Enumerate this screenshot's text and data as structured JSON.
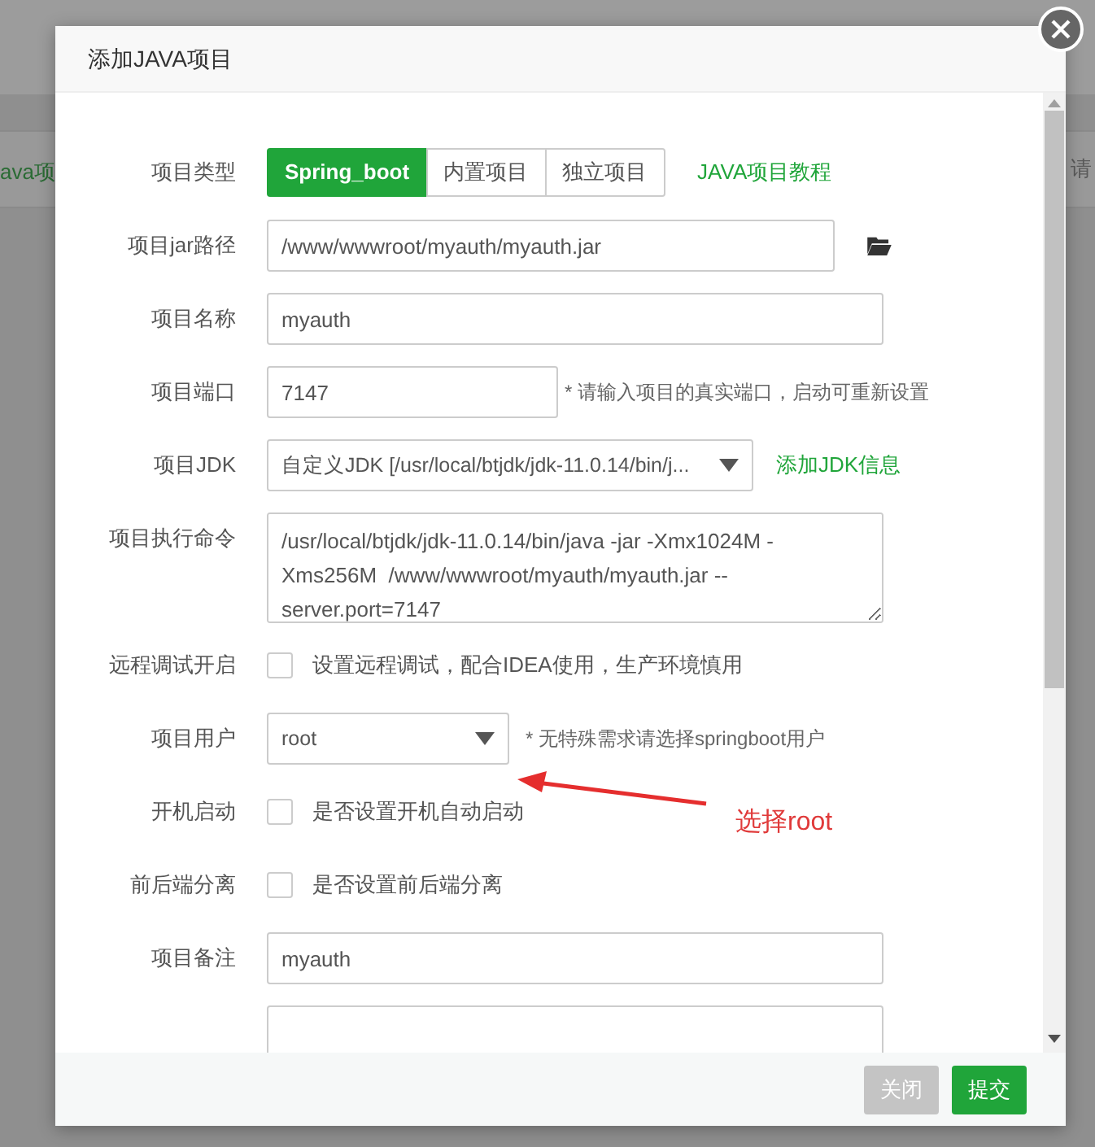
{
  "background": {
    "texts": [
      "ava项",
      "请"
    ]
  },
  "dialog": {
    "title": "添加JAVA项目",
    "fields": [
      {
        "kind": "segmented",
        "label": "项目类型",
        "options": [
          {
            "label": "Spring_boot",
            "selected": true
          },
          {
            "label": "内置项目",
            "selected": false
          },
          {
            "label": "独立项目",
            "selected": false
          }
        ],
        "link": "JAVA项目教程"
      },
      {
        "kind": "path",
        "label": "项目jar路径",
        "value": "/www/wwwroot/myauth/myauth.jar"
      },
      {
        "kind": "text",
        "label": "项目名称",
        "value": "myauth"
      },
      {
        "kind": "short",
        "label": "项目端口",
        "value": "7147",
        "hint": "* 请输入项目的真实端口，启动可重新设置"
      },
      {
        "kind": "select",
        "label": "项目JDK",
        "value": "自定义JDK [/usr/local/btjdk/jdk-11.0.14/bin/j...",
        "link": "添加JDK信息"
      },
      {
        "kind": "textarea",
        "label": "项目执行命令",
        "value": "/usr/local/btjdk/jdk-11.0.14/bin/java -jar -Xmx1024M -Xms256M  /www/wwwroot/myauth/myauth.jar --server.port=7147"
      },
      {
        "kind": "checkbox",
        "label": "远程调试开启",
        "checked": false,
        "text": "设置远程调试，配合IDEA使用，生产环境慎用"
      },
      {
        "kind": "user",
        "label": "项目用户",
        "value": "root",
        "hint": "* 无特殊需求请选择springboot用户"
      },
      {
        "kind": "checkbox",
        "label": "开机启动",
        "checked": false,
        "text": "是否设置开机自动启动"
      },
      {
        "kind": "checkbox",
        "label": "前后端分离",
        "checked": false,
        "text": "是否设置前后端分离"
      },
      {
        "kind": "text",
        "label": "项目备注",
        "value": "myauth"
      },
      {
        "kind": "cut"
      }
    ],
    "buttons": [
      {
        "label": "关闭",
        "kind": "secondary"
      },
      {
        "label": "提交",
        "kind": "primary"
      }
    ]
  },
  "annotation": {
    "text": "选择root"
  }
}
